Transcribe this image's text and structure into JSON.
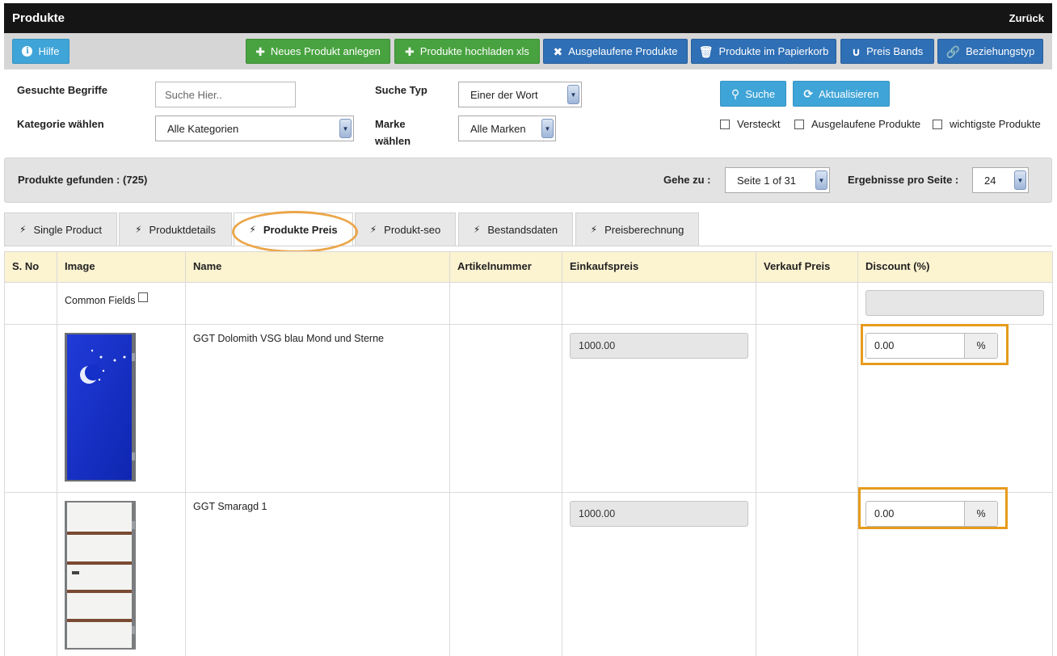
{
  "window": {
    "title": "Produkte",
    "back_label": "Zurück"
  },
  "toolbar": {
    "help_label": "Hilfe",
    "new_product_label": "Neues Produkt anlegen",
    "upload_xls_label": "Produkte hochladen xls",
    "discontinued_label": "Ausgelaufene Produkte",
    "trash_label": "Produkte im Papierkorb",
    "price_bands_label": "Preis Bands",
    "relation_type_label": "Beziehungstyp"
  },
  "filters": {
    "search_terms_label": "Gesuchte Begriffe",
    "search_placeholder": "Suche Hier..",
    "search_type_label": "Suche Typ",
    "search_type_value": "Einer der Wort",
    "category_label": "Kategorie wählen",
    "category_value": "Alle Kategorien",
    "brand_label_1": "Marke",
    "brand_label_2": "wählen",
    "brand_value": "Alle Marken",
    "search_button": "Suche",
    "refresh_button": "Aktualisieren",
    "checkboxes": [
      "Versteckt",
      "Ausgelaufene Produkte",
      "wichtigste Produkte"
    ]
  },
  "results": {
    "found_label": "Produkte gefunden : (725)",
    "goto_label": "Gehe zu :",
    "page_value": "Seite 1 of 31",
    "per_page_label": "Ergebnisse pro Seite :",
    "per_page_value": "24"
  },
  "tabs": [
    "Single Product",
    "Produktdetails",
    "Produkte Preis",
    "Produkt-seo",
    "Bestandsdaten",
    "Preisberechnung"
  ],
  "active_tab": "Produkte Preis",
  "table": {
    "headers": [
      "S. No",
      "Image",
      "Name",
      "Artikelnummer",
      "Einkaufspreis",
      "Verkauf Preis",
      "Discount (%)"
    ],
    "common_fields_label": "Common Fields",
    "rows": [
      {
        "name": "GGT Dolomith VSG blau Mond und Sterne",
        "purchase_price": "1000.00",
        "discount": "0.00",
        "discount_unit": "%"
      },
      {
        "name": "GGT Smaragd 1",
        "purchase_price": "1000.00",
        "discount": "0.00",
        "discount_unit": "%"
      }
    ]
  },
  "colors": {
    "highlight": "#e69b1c",
    "header_row": "#fcf3d0",
    "btn_blue": "#2f6fb5",
    "btn_green": "#48a23f"
  }
}
